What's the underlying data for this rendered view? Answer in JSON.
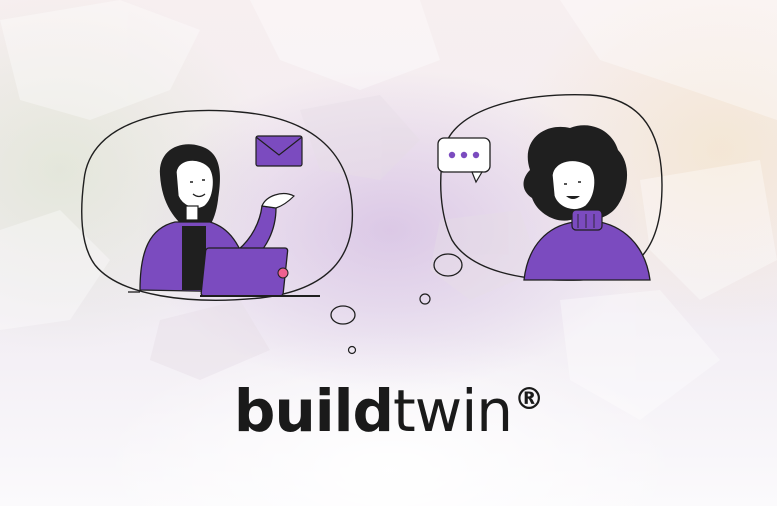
{
  "brand": {
    "name_bold": "build",
    "name_light": "twin",
    "registered": "®"
  },
  "colors": {
    "accent_purple": "#7b4bbf",
    "outline": "#1f1f1f"
  },
  "illustration": {
    "left_person_icons": [
      "envelope-icon",
      "laptop-icon"
    ],
    "right_person_icons": [
      "chat-typing-icon"
    ]
  }
}
